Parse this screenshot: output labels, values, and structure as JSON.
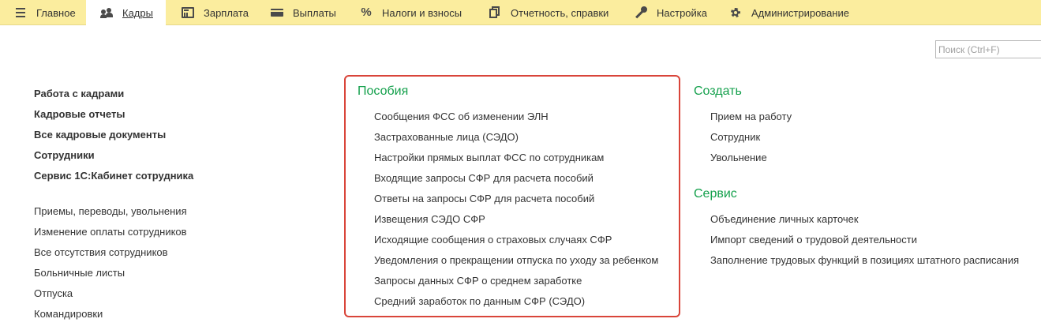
{
  "menu": {
    "tabs": [
      {
        "label": "Главное",
        "icon": "menu-icon"
      },
      {
        "label": "Кадры",
        "icon": "users-icon",
        "active": true
      },
      {
        "label": "Зарплата",
        "icon": "calculator-icon"
      },
      {
        "label": "Выплаты",
        "icon": "wallet-icon"
      },
      {
        "label": "Налоги и взносы",
        "icon": "percent-icon"
      },
      {
        "label": "Отчетность, справки",
        "icon": "documents-icon"
      },
      {
        "label": "Настройка",
        "icon": "wrench-icon"
      },
      {
        "label": "Администрирование",
        "icon": "gear-icon"
      }
    ]
  },
  "search": {
    "placeholder": "Поиск (Ctrl+F)"
  },
  "left": {
    "main_links": [
      "Работа с кадрами",
      "Кадровые отчеты",
      "Все кадровые документы",
      "Сотрудники",
      "Сервис 1С:Кабинет сотрудника"
    ],
    "doc_links": [
      "Приемы, переводы, увольнения",
      "Изменение оплаты сотрудников",
      "Все отсутствия сотрудников",
      "Больничные листы",
      "Отпуска",
      "Командировки"
    ]
  },
  "benefits": {
    "title": "Пособия",
    "links": [
      "Сообщения ФСС об изменении ЭЛН",
      "Застрахованные лица (СЭДО)",
      "Настройки прямых выплат ФСС по сотрудникам",
      "Входящие запросы СФР для расчета пособий",
      "Ответы на запросы СФР для расчета пособий",
      "Извещения СЭДО СФР",
      "Исходящие сообщения о страховых случаях СФР",
      "Уведомления о прекращении отпуска по уходу за ребенком",
      "Запросы данных СФР о среднем заработке",
      "Средний заработок по данным СФР (СЭДО)"
    ],
    "highlight_color": "#d9453a"
  },
  "create": {
    "title": "Создать",
    "links": [
      "Прием на работу",
      "Сотрудник",
      "Увольнение"
    ]
  },
  "service": {
    "title": "Сервис",
    "links": [
      "Объединение личных карточек",
      "Импорт сведений о трудовой деятельности",
      "Заполнение трудовых функций в позициях штатного расписания"
    ]
  },
  "colors": {
    "menu_bg": "#fbed9e",
    "group_title": "#14a04c",
    "text": "#333333"
  }
}
